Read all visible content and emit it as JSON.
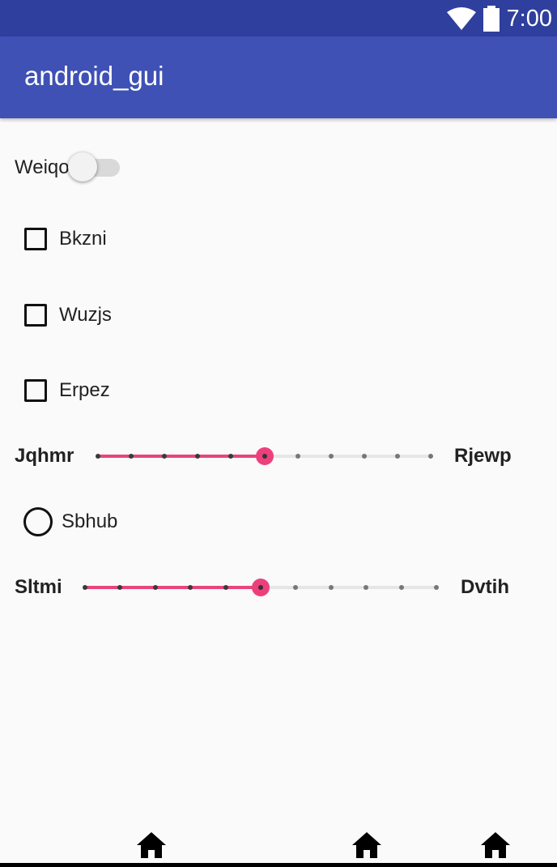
{
  "status_bar": {
    "time": "7:00",
    "icons": [
      "wifi-icon",
      "battery-icon"
    ]
  },
  "app_bar": {
    "title": "android_gui"
  },
  "switch": {
    "label": "Weiqo",
    "checked": false
  },
  "checkboxes": [
    {
      "label": "Bkzni",
      "checked": false
    },
    {
      "label": "Wuzjs",
      "checked": false
    },
    {
      "label": "Erpez",
      "checked": false
    }
  ],
  "radio": {
    "label": "Sbhub",
    "checked": false
  },
  "slider1": {
    "left_label": "Jqhmr",
    "right_label": "Rjewp",
    "ticks": 11,
    "value": 5
  },
  "slider2": {
    "left_label": "Sltmi",
    "right_label": "Dvtih",
    "ticks": 11,
    "value": 5
  },
  "nav_bar": {
    "icons": [
      "home-icon",
      "home-icon",
      "home-icon"
    ]
  },
  "colors": {
    "status_bar": "#2f3f9e",
    "app_bar": "#3f51b5",
    "accent": "#ee3f7d"
  }
}
